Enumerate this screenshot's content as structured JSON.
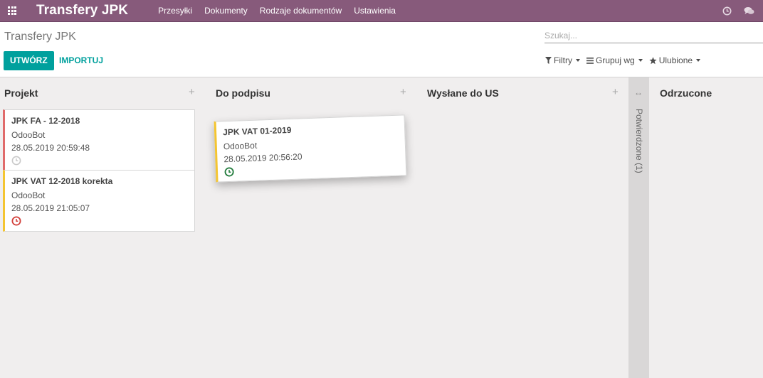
{
  "navbar": {
    "brand": "Transfery JPK",
    "menu": [
      "Przesyłki",
      "Dokumenty",
      "Rodzaje dokumentów",
      "Ustawienia"
    ]
  },
  "control": {
    "breadcrumb": "Transfery JPK",
    "create_label": "UTWÓRZ",
    "import_label": "IMPORTUJ",
    "search_placeholder": "Szukaj...",
    "filters_label": "Filtry",
    "groupby_label": "Grupuj wg",
    "favorites_label": "Ulubione"
  },
  "columns": [
    {
      "title": "Projekt"
    },
    {
      "title": "Do podpisu"
    },
    {
      "title": "Wysłane do US"
    },
    {
      "title": "Odrzucone"
    }
  ],
  "folded_column": {
    "title": "Potwierdzone",
    "count": "(1)"
  },
  "cards": [
    {
      "title": "JPK FA - 12-2018",
      "user": "OdooBot",
      "date": "28.05.2019 20:59:48",
      "color": "#e06a6a",
      "status": "clock-grey-icon"
    },
    {
      "title": "JPK VAT 12-2018 korekta",
      "user": "OdooBot",
      "date": "28.05.2019 21:05:07",
      "color": "#f4c531",
      "status": "clock-red-icon"
    },
    {
      "title": "JPK VAT 01-2019",
      "user": "OdooBot",
      "date": "28.05.2019 20:56:20",
      "color": "#f4c531",
      "status": "clock-green-icon"
    }
  ],
  "colors": {
    "navbar": "#875a7b",
    "primary": "#00a09d"
  }
}
